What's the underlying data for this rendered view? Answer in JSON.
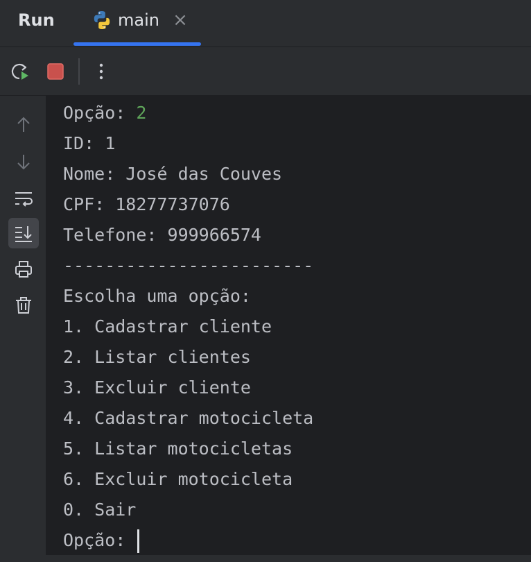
{
  "header": {
    "run_title": "Run",
    "tab": {
      "label": "main",
      "icon": "python-icon",
      "close_glyph": "×"
    },
    "accent_color": "#3574f0"
  },
  "toolbar": {
    "items": [
      {
        "name": "rerun-button",
        "icon": "rerun-icon"
      },
      {
        "name": "stop-button",
        "icon": "stop-icon"
      },
      {
        "name": "more-options-button",
        "icon": "more-vertical-icon"
      }
    ]
  },
  "gutter": {
    "items": [
      {
        "name": "scroll-up-button",
        "icon": "arrow-up-icon"
      },
      {
        "name": "scroll-down-button",
        "icon": "arrow-down-icon"
      },
      {
        "name": "soft-wrap-button",
        "icon": "soft-wrap-icon"
      },
      {
        "name": "scroll-to-end-button",
        "icon": "scroll-to-end-icon",
        "active": true
      },
      {
        "name": "print-button",
        "icon": "print-icon"
      },
      {
        "name": "clear-all-button",
        "icon": "trash-icon"
      }
    ]
  },
  "console": {
    "lines": [
      {
        "prompt": "Opção: ",
        "input": "2"
      },
      {
        "text": "ID: 1"
      },
      {
        "text": "Nome: José das Couves"
      },
      {
        "text": "CPF: 18277737076"
      },
      {
        "text": "Telefone: 999966574"
      },
      {
        "text": "------------------------"
      },
      {
        "text": "Escolha uma opção:"
      },
      {
        "text": "1. Cadastrar cliente"
      },
      {
        "text": "2. Listar clientes"
      },
      {
        "text": "3. Excluir cliente"
      },
      {
        "text": "4. Cadastrar motocicleta"
      },
      {
        "text": "5. Listar motocicletas"
      },
      {
        "text": "6. Excluir motocicleta"
      },
      {
        "text": "0. Sair"
      },
      {
        "prompt": "Opção: ",
        "input": ""
      }
    ],
    "input_color": "#5fa55a"
  }
}
